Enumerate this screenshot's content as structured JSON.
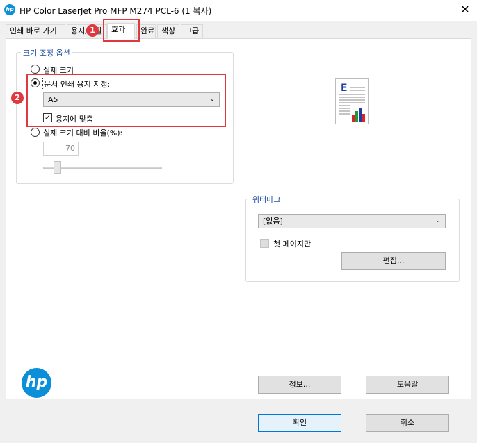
{
  "window": {
    "title": "HP Color LaserJet Pro MFP M274 PCL-6 (1 복사)",
    "app_icon_text": "hp",
    "close_glyph": "✕"
  },
  "tabs": [
    {
      "label": "인쇄 바로 가기"
    },
    {
      "label": "용지/품질"
    },
    {
      "label": "효과"
    },
    {
      "label": "완료"
    },
    {
      "label": "색상"
    },
    {
      "label": "고급"
    }
  ],
  "active_tab": "효과",
  "resize": {
    "group_label": "크기 조정 옵션",
    "options": [
      {
        "label": "실제 크기",
        "checked": false
      },
      {
        "label": "문서 인쇄 용지 지정:",
        "checked": true
      },
      {
        "label": "실제 크기 대비 비율(%):",
        "checked": false
      }
    ],
    "paper_select": "A5",
    "fit_checkbox_label": "용지에 맞춤",
    "fit_checked": true,
    "percent_value": "70",
    "percent_slider": 0.2
  },
  "watermark": {
    "group_label": "워터마크",
    "select_value": "[없음]",
    "first_page_label": "첫 페이지만",
    "first_page_checked": false,
    "edit_button": "편집..."
  },
  "bottom": {
    "info_button": "정보...",
    "help_button": "도움말",
    "ok_button": "확인",
    "cancel_button": "취소"
  },
  "annotations": [
    {
      "number": "1"
    },
    {
      "number": "2"
    }
  ],
  "preview": {
    "letter": "E"
  },
  "logo_text": "hp",
  "colors": {
    "accent": "#0078d7",
    "group_label": "#1f4ea3",
    "annotation_red": "#e0383f",
    "hp_blue": "#0a8fd8"
  }
}
